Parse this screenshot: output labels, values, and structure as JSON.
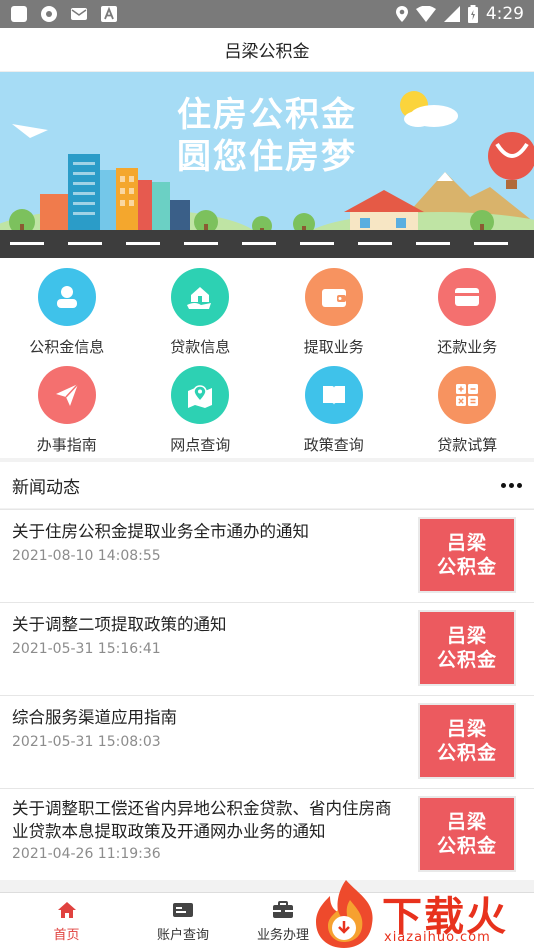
{
  "status_bar": {
    "time": "4:29"
  },
  "header": {
    "title": "吕梁公积金"
  },
  "banner": {
    "line1": "住房公积金",
    "line2": "圆您住房梦"
  },
  "services": [
    {
      "label": "公积金信息",
      "color": "#3fc2ea",
      "icon": "person-icon"
    },
    {
      "label": "贷款信息",
      "color": "#2dd1b3",
      "icon": "house-hand-icon"
    },
    {
      "label": "提取业务",
      "color": "#f79360",
      "icon": "wallet-icon"
    },
    {
      "label": "还款业务",
      "color": "#f4706f",
      "icon": "card-icon"
    },
    {
      "label": "办事指南",
      "color": "#f4706f",
      "icon": "paper-plane-icon"
    },
    {
      "label": "网点查询",
      "color": "#2dd1b3",
      "icon": "map-pin-icon"
    },
    {
      "label": "政策查询",
      "color": "#3fc2ea",
      "icon": "book-icon"
    },
    {
      "label": "贷款试算",
      "color": "#f79360",
      "icon": "calculator-icon"
    }
  ],
  "news": {
    "title": "新闻动态",
    "thumb_line1": "吕梁",
    "thumb_line2": "公积金",
    "items": [
      {
        "title": "关于住房公积金提取业务全市通办的通知",
        "date": "2021-08-10 14:08:55"
      },
      {
        "title": "关于调整二项提取政策的通知",
        "date": "2021-05-31 15:16:41"
      },
      {
        "title": "综合服务渠道应用指南",
        "date": "2021-05-31 15:08:03"
      },
      {
        "title": "关于调整职工偿还省内异地公积金贷款、省内住房商业贷款本息提取政策及开通网办业务的通知",
        "date": "2021-04-26 11:19:36"
      }
    ]
  },
  "bottom_nav": {
    "tabs": [
      {
        "label": "首页",
        "active": true
      },
      {
        "label": "账户查询",
        "active": false
      },
      {
        "label": "业务办理",
        "active": false
      }
    ]
  },
  "watermark": {
    "text": "下载火",
    "url": "xiazaihuo.com"
  },
  "colors": {
    "accent": "#e0423f",
    "thumb": "#ec5a5f",
    "status_bar": "#7a7a7a"
  }
}
